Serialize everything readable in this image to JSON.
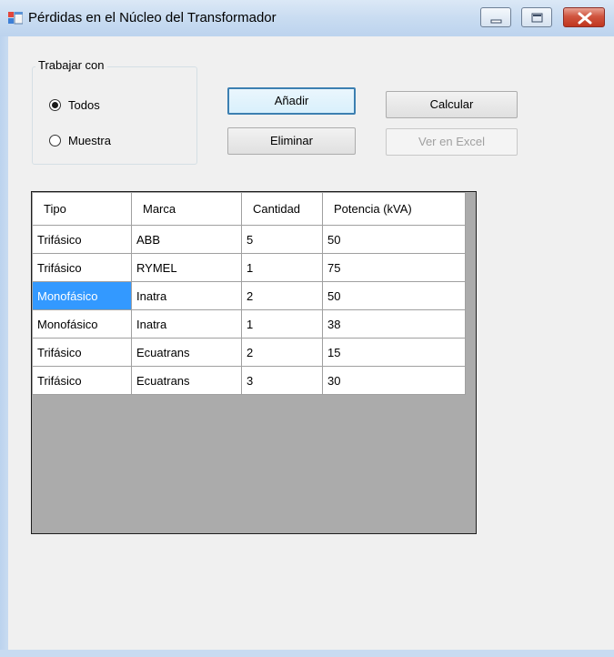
{
  "window": {
    "title": "Pérdidas en el Núcleo del Transformador"
  },
  "group": {
    "title": "Trabajar con",
    "options": [
      {
        "label": "Todos",
        "selected": true
      },
      {
        "label": "Muestra",
        "selected": false
      }
    ]
  },
  "buttons": {
    "add": "Añadir",
    "delete": "Eliminar",
    "calculate": "Calcular",
    "excel": "Ver en Excel"
  },
  "table": {
    "columns": [
      "Tipo",
      "Marca",
      "Cantidad",
      "Potencia (kVA)"
    ],
    "rows": [
      [
        "Trifásico",
        "ABB",
        "5",
        "50"
      ],
      [
        "Trifásico",
        "RYMEL",
        "1",
        "75"
      ],
      [
        "Monofásico",
        "Inatra",
        "2",
        "50"
      ],
      [
        "Monofásico",
        "Inatra",
        "1",
        "38"
      ],
      [
        "Trifásico",
        "Ecuatrans",
        "2",
        "15"
      ],
      [
        "Trifásico",
        "Ecuatrans",
        "3",
        "30"
      ]
    ],
    "selected_cell": {
      "row": 2,
      "col": 0
    }
  },
  "colors": {
    "selection": "#3399ff",
    "grid_background": "#ababab",
    "close_button": "#c0361e"
  },
  "icons": {
    "app": "app-window-icon",
    "minimize": "minimize-icon",
    "maximize": "maximize-icon",
    "close": "close-icon"
  }
}
